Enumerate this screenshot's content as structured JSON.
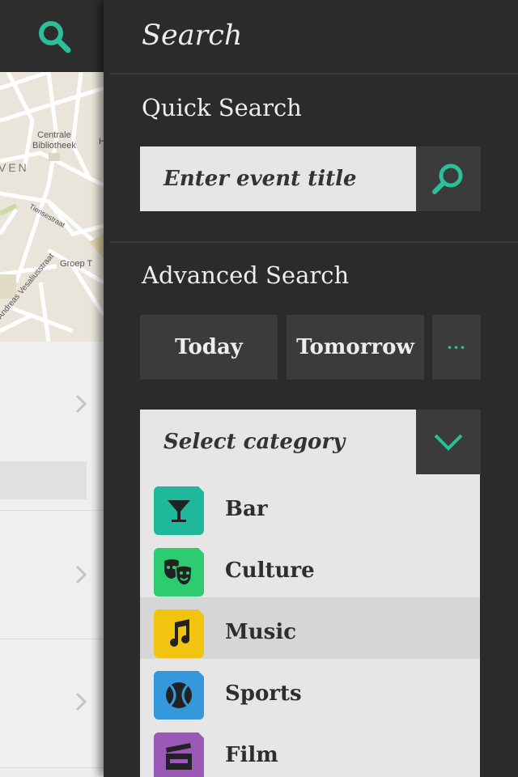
{
  "background": {
    "map": {
      "labels": [
        "Centrale",
        "Bibliotheek",
        "VEN",
        "Tiensestraat",
        "Groep T",
        "Andreas Vesaliusstraat",
        "H"
      ]
    }
  },
  "drawer": {
    "title": "Search",
    "quick_search": {
      "heading": "Quick Search",
      "input": {
        "placeholder": "Enter event title",
        "value": ""
      }
    },
    "advanced_search": {
      "heading": "Advanced Search",
      "date_buttons": [
        "Today",
        "Tomorrow"
      ],
      "more_label": "···",
      "category_select": {
        "placeholder": "Select category"
      },
      "categories": [
        {
          "label": "Bar",
          "icon": "cocktail-icon",
          "color": "#1fb89a"
        },
        {
          "label": "Culture",
          "icon": "theater-masks-icon",
          "color": "#2ecc71"
        },
        {
          "label": "Music",
          "icon": "music-note-icon",
          "color": "#f1c40f",
          "selected": true
        },
        {
          "label": "Sports",
          "icon": "tennis-ball-icon",
          "color": "#3498db"
        },
        {
          "label": "Film",
          "icon": "clapperboard-icon",
          "color": "#9b59b6"
        }
      ]
    }
  },
  "colors": {
    "accent": "#2bbf9a",
    "drawer_bg": "#2b2b2b",
    "button_bg": "#3b3b3b",
    "input_bg": "#e6e6e6"
  }
}
